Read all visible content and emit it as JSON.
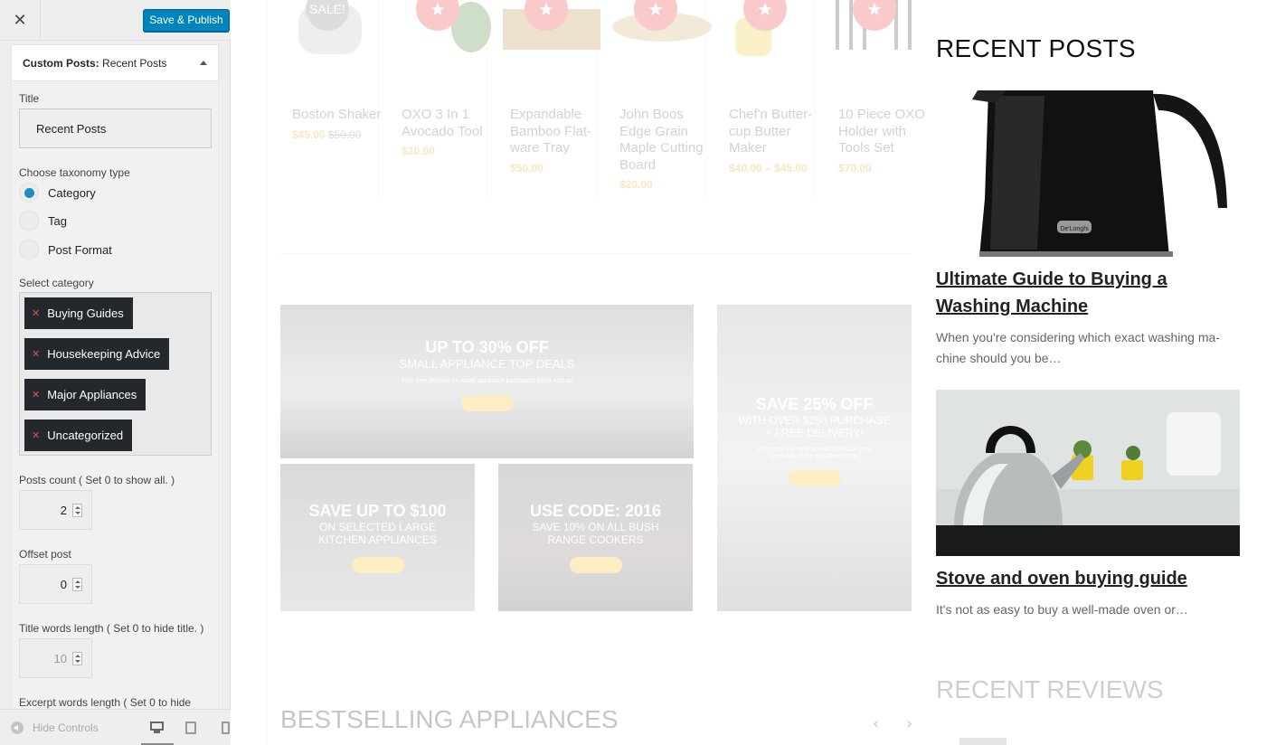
{
  "topbar": {
    "close_label": "✕",
    "publish_label": "Save & Publish"
  },
  "widget": {
    "title_prefix": "Custom Posts:",
    "title_name": "Recent Posts",
    "title_field_label": "Title",
    "title_value": "Recent Posts",
    "taxonomy_label": "Choose taxonomy type",
    "taxonomy_options": [
      "Category",
      "Tag",
      "Post Format"
    ],
    "taxonomy_selected": "Category",
    "category_label": "Select category",
    "categories": [
      "Buying Guides",
      "Housekeeping Advice",
      "Major Appliances",
      "Uncategorized"
    ],
    "posts_count_label": "Posts count ( Set 0 to show all. )",
    "posts_count": "2",
    "offset_label": "Offset post",
    "offset": "0",
    "title_words_label": "Title words length ( Set 0 to hide title. )",
    "title_words": "10",
    "excerpt_words_label": "Excerpt words length ( Set 0 to hide"
  },
  "footer": {
    "hide_controls": "Hide Controls"
  },
  "preview": {
    "products": [
      {
        "name": "Boston Shaker",
        "price": "$45.00",
        "old_price": "$50.00",
        "badge": "SALE!"
      },
      {
        "name": "OXO 3 In 1 Avocado Tool",
        "price": "$20.00",
        "old_price": "",
        "badge": "★"
      },
      {
        "name": "Expandable Bamboo Flat-ware Tray",
        "price": "$50.00",
        "old_price": "",
        "badge": "★"
      },
      {
        "name": "John Boos Edge Grain Maple Cutting Board",
        "price": "$20.00",
        "old_price": "",
        "badge": "★"
      },
      {
        "name": "Chef'n Butter-cup Butter Maker",
        "price": "$40.00 – $45.00",
        "old_price": "",
        "badge": "★"
      },
      {
        "name": "10 Piece OXO Holder with Tools Set",
        "price": "$70.00",
        "old_price": "",
        "badge": "★"
      }
    ],
    "banners": [
      {
        "heading": "UP TO 30% OFF",
        "sub": "SMALL APPLIANCE TOP DEALS",
        "small": "Plus free delivery on small appliance purchases $199 and up",
        "button": "Shop now"
      },
      {
        "heading": "SAVE 25% OFF",
        "sub": "WITH OVER $250 PURCHASE",
        "sub2": "+ FREE DELIVERY!",
        "small": "Purchase the softest mattresses for your bedroom, twice as cheap today",
        "button": "Shop now"
      },
      {
        "heading": "SAVE UP TO $100",
        "sub": "ON SELECTED LARGE",
        "sub2": "KITCHEN APPLIANCES",
        "button": "Shop now"
      },
      {
        "heading": "USE CODE: 2016",
        "sub": "SAVE 10% ON ALL BUSH",
        "sub2": "RANGE COOKERS",
        "button": "Shop now"
      }
    ],
    "bestselling_heading": "BESTSELLING APPLIANCES",
    "arrows": {
      "prev": "‹",
      "next": "›"
    },
    "recent_posts_heading": "RECENT POSTS",
    "posts": [
      {
        "title": "Ultimate Guide to Buying a Washing Machine",
        "excerpt": "When you're considering which exact washing ma-chine should you be…",
        "image": "black-kettle"
      },
      {
        "title": "Stove and oven buying guide",
        "excerpt": "It's not as easy to buy a well-made oven or…",
        "image": "steel-kettle-on-hob"
      }
    ],
    "recent_reviews_heading": "RECENT REVIEWS",
    "kettle_brand": "De'Longhi"
  }
}
